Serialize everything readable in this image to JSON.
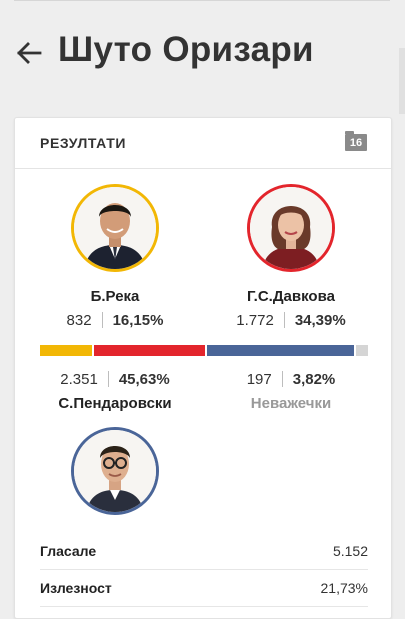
{
  "header": {
    "title": "Шуто Оризари",
    "back_icon": "arrow-left-icon"
  },
  "card": {
    "title": "РЕЗУЛТАТИ",
    "badge": "16",
    "badge_icon": "folder-icon"
  },
  "candidates": [
    {
      "name": "Б.Река",
      "votes": "832",
      "percent": "16,15%",
      "color": "#f2b705",
      "share": 0.1615
    },
    {
      "name": "Г.С.Давкова",
      "votes": "1.772",
      "percent": "34,39%",
      "color": "#e3252c",
      "share": 0.3439
    },
    {
      "name": "С.Пендаровски",
      "votes": "2.351",
      "percent": "45,63%",
      "color": "#4a6598",
      "share": 0.4563
    },
    {
      "name": "Неважечки",
      "votes": "197",
      "percent": "3,82%",
      "color": "#d5d5d5",
      "share": 0.0382
    }
  ],
  "summary": [
    {
      "label": "Гласале",
      "value": "5.152"
    },
    {
      "label": "Излезност",
      "value": "21,73%"
    }
  ]
}
